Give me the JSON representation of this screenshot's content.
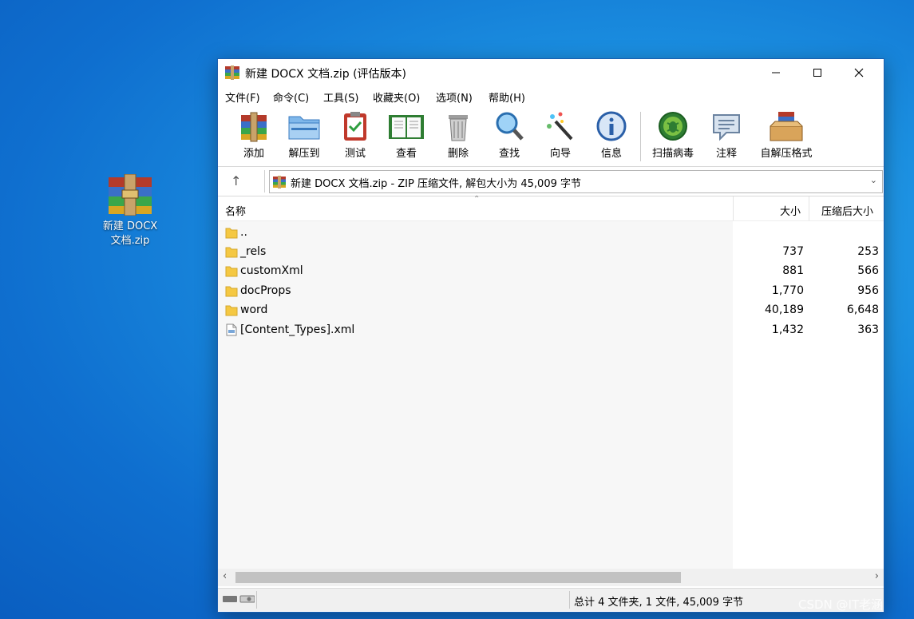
{
  "desktop": {
    "icon_label_line1": "新建 DOCX",
    "icon_label_line2": "文档.zip",
    "icon_name": "winrar-archive-icon"
  },
  "window": {
    "title": "新建 DOCX 文档.zip (评估版本)",
    "controls": {
      "minimize": "minimize-icon",
      "maximize": "maximize-icon",
      "close": "close-icon"
    }
  },
  "menu": [
    {
      "label": "文件(F)"
    },
    {
      "label": "命令(C)"
    },
    {
      "label": "工具(S)"
    },
    {
      "label": "收藏夹(O)"
    },
    {
      "label": "选项(N)"
    },
    {
      "label": "帮助(H)"
    }
  ],
  "toolbar": [
    {
      "label": "添加",
      "icon": "add-archive-icon"
    },
    {
      "label": "解压到",
      "icon": "extract-folder-icon"
    },
    {
      "label": "测试",
      "icon": "test-clipboard-icon"
    },
    {
      "label": "查看",
      "icon": "view-book-icon"
    },
    {
      "label": "删除",
      "icon": "trash-icon"
    },
    {
      "label": "查找",
      "icon": "magnifier-icon"
    },
    {
      "label": "向导",
      "icon": "wizard-wand-icon"
    },
    {
      "label": "信息",
      "icon": "info-icon"
    },
    {
      "label": "扫描病毒",
      "icon": "virus-scan-icon"
    },
    {
      "label": "注释",
      "icon": "comment-icon"
    },
    {
      "label": "自解压格式",
      "icon": "sfx-box-icon"
    }
  ],
  "address": {
    "text": "新建 DOCX 文档.zip - ZIP 压缩文件, 解包大小为 45,009 字节"
  },
  "columns": {
    "name": "名称",
    "size": "大小",
    "packed": "压缩后大小"
  },
  "files": [
    {
      "name": "..",
      "size": "",
      "packed": "",
      "type": "folder"
    },
    {
      "name": "_rels",
      "size": "737",
      "packed": "253",
      "type": "folder"
    },
    {
      "name": "customXml",
      "size": "881",
      "packed": "566",
      "type": "folder"
    },
    {
      "name": "docProps",
      "size": "1,770",
      "packed": "956",
      "type": "folder"
    },
    {
      "name": "word",
      "size": "40,189",
      "packed": "6,648",
      "type": "folder"
    },
    {
      "name": "[Content_Types].xml",
      "size": "1,432",
      "packed": "363",
      "type": "file"
    }
  ],
  "status": {
    "summary": "总计 4 文件夹, 1 文件, 45,009 字节"
  },
  "watermark": "CSDN @IT老涵",
  "colors": {
    "desktop": "#1b8fe0",
    "window_border": "#1a5fb0",
    "folder": "#f5c842"
  }
}
